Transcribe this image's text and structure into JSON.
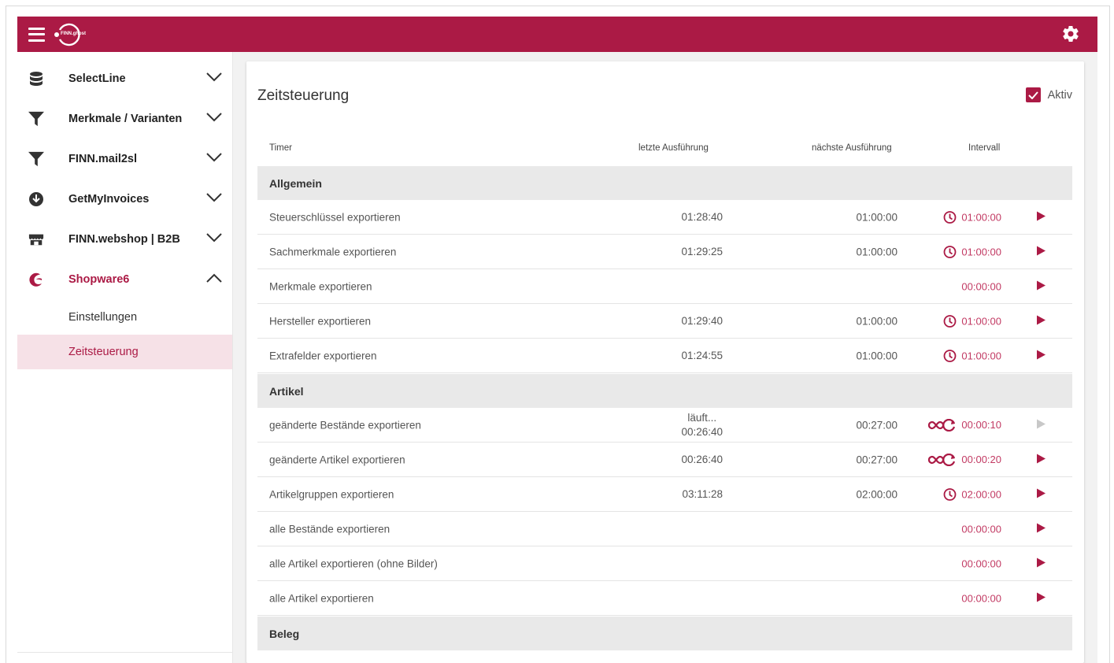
{
  "header": {
    "logo_text": "FINN.ghost",
    "menu_icon": "hamburger-icon",
    "settings_icon": "gear-icon",
    "brand_color": "#ab1a45"
  },
  "sidebar": {
    "items": [
      {
        "label": "SelectLine",
        "icon": "database-icon",
        "expanded": false
      },
      {
        "label": "Merkmale / Varianten",
        "icon": "filter-icon",
        "expanded": false
      },
      {
        "label": "FINN.mail2sl",
        "icon": "filter-icon",
        "expanded": false
      },
      {
        "label": "GetMyInvoices",
        "icon": "download-circle-icon",
        "expanded": false
      },
      {
        "label": "FINN.webshop | B2B",
        "icon": "store-icon",
        "expanded": false
      },
      {
        "label": "Shopware6",
        "icon": "shopware-icon",
        "expanded": true
      }
    ],
    "subitems": [
      {
        "label": "Einstellungen",
        "selected": false
      },
      {
        "label": "Zeitsteuerung",
        "selected": true
      }
    ]
  },
  "main": {
    "title": "Zeitsteuerung",
    "aktiv_label": "Aktiv",
    "aktiv_checked": true,
    "columns": {
      "timer": "Timer",
      "last": "letzte Ausführung",
      "next": "nächste Ausführung",
      "interval": "Intervall"
    },
    "groups": [
      {
        "name": "Allgemein",
        "rows": [
          {
            "name": "Steuerschlüssel exportieren",
            "last": "01:28:40",
            "next": "01:00:00",
            "interval": "01:00:00",
            "interval_icon": "clock-icon",
            "play_enabled": true
          },
          {
            "name": "Sachmerkmale exportieren",
            "last": "01:29:25",
            "next": "01:00:00",
            "interval": "01:00:00",
            "interval_icon": "clock-icon",
            "play_enabled": true
          },
          {
            "name": "Merkmale exportieren",
            "last": "",
            "next": "",
            "interval": "00:00:00",
            "interval_icon": "",
            "play_enabled": true
          },
          {
            "name": "Hersteller exportieren",
            "last": "01:29:40",
            "next": "01:00:00",
            "interval": "01:00:00",
            "interval_icon": "clock-icon",
            "play_enabled": true
          },
          {
            "name": "Extrafelder exportieren",
            "last": "01:24:55",
            "next": "01:00:00",
            "interval": "01:00:00",
            "interval_icon": "clock-icon",
            "play_enabled": true
          }
        ]
      },
      {
        "name": "Artikel",
        "rows": [
          {
            "name": "geänderte Bestände exportieren",
            "last_status": "läuft...",
            "last": "00:26:40",
            "next": "00:27:00",
            "interval": "00:00:10",
            "interval_icon": "infinity-repeat-icon",
            "play_enabled": false
          },
          {
            "name": "geänderte Artikel exportieren",
            "last": "00:26:40",
            "next": "00:27:00",
            "interval": "00:00:20",
            "interval_icon": "infinity-repeat-icon",
            "play_enabled": true
          },
          {
            "name": "Artikelgruppen exportieren",
            "last": "03:11:28",
            "next": "02:00:00",
            "interval": "02:00:00",
            "interval_icon": "clock-icon",
            "play_enabled": true
          },
          {
            "name": "alle Bestände exportieren",
            "last": "",
            "next": "",
            "interval": "00:00:00",
            "interval_icon": "",
            "play_enabled": true
          },
          {
            "name": "alle Artikel exportieren (ohne Bilder)",
            "last": "",
            "next": "",
            "interval": "00:00:00",
            "interval_icon": "",
            "play_enabled": true
          },
          {
            "name": "alle Artikel exportieren",
            "last": "",
            "next": "",
            "interval": "00:00:00",
            "interval_icon": "",
            "play_enabled": true
          }
        ]
      },
      {
        "name": "Beleg",
        "rows": []
      }
    ]
  }
}
